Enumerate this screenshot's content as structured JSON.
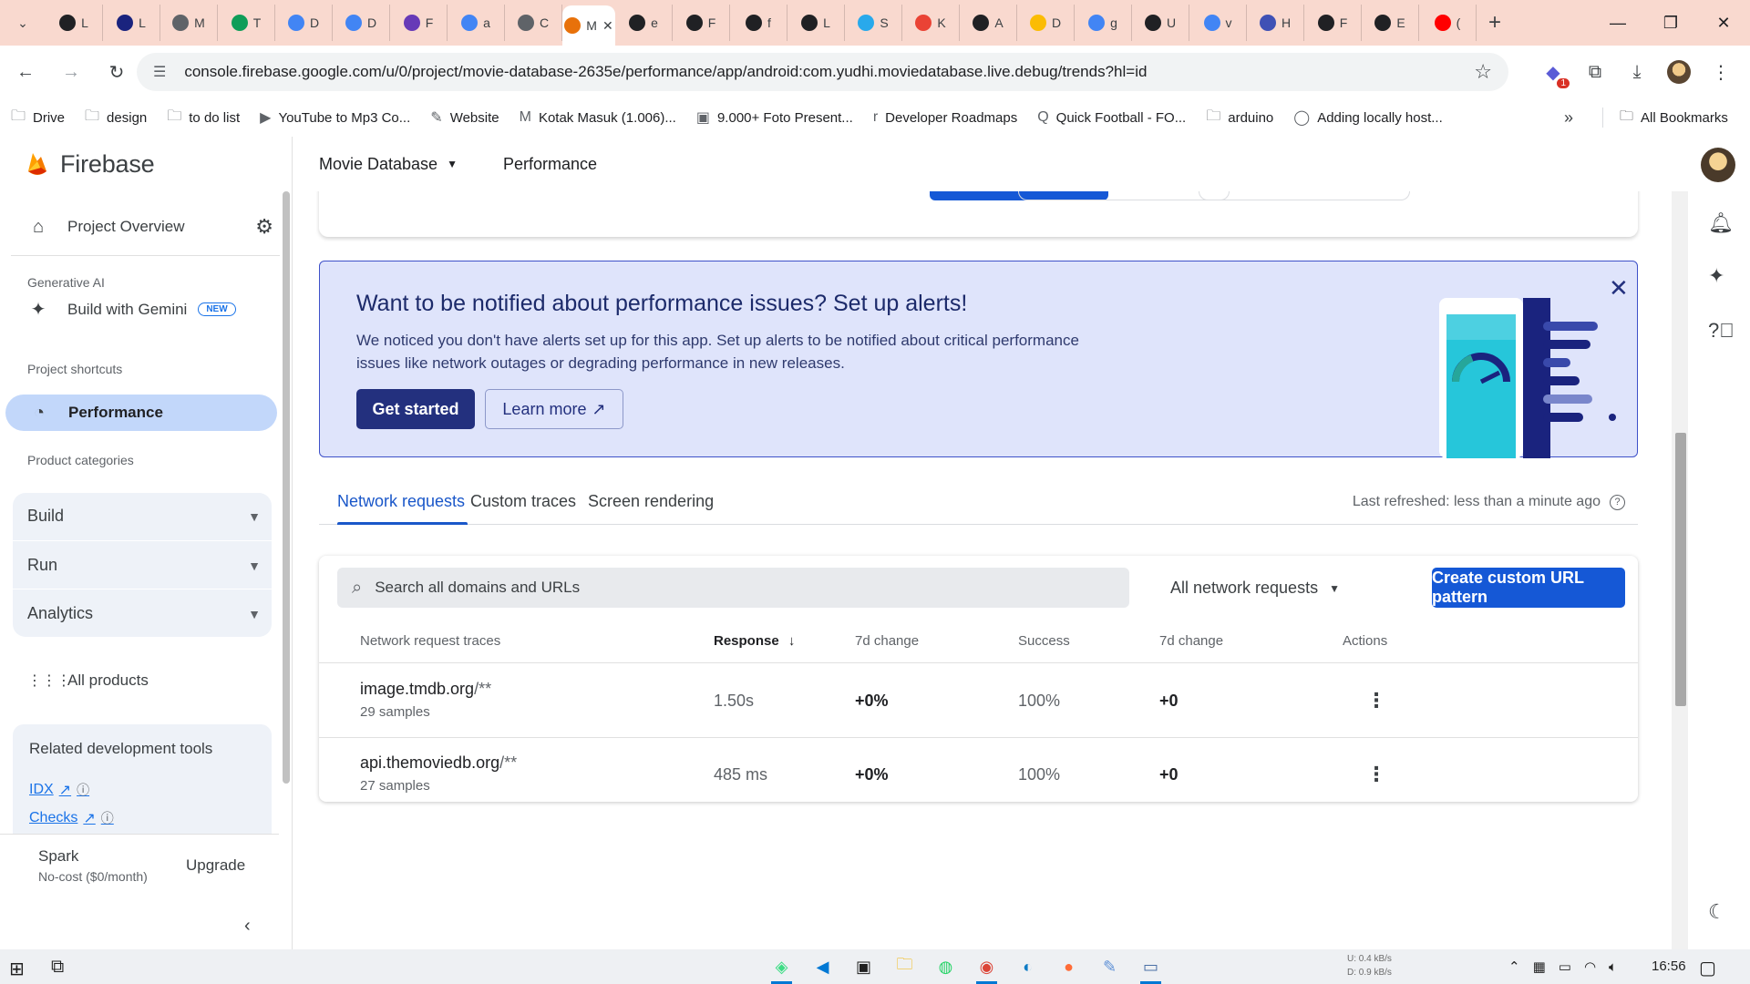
{
  "browser": {
    "tabs": [
      {
        "letter": "L",
        "color": "#202124"
      },
      {
        "letter": "L",
        "color": "#1a237e"
      },
      {
        "letter": "M",
        "color": "#5f6368"
      },
      {
        "letter": "T",
        "color": "#0f9d58"
      },
      {
        "letter": "D",
        "color": "#4285f4"
      },
      {
        "letter": "D",
        "color": "#4285f4"
      },
      {
        "letter": "F",
        "color": "#673ab7"
      },
      {
        "letter": "a",
        "color": "#4285f4"
      },
      {
        "letter": "C",
        "color": "#5f6368"
      },
      {
        "letter": "M",
        "color": "#e8710a",
        "active": true
      },
      {
        "letter": "e",
        "color": "#202124"
      },
      {
        "letter": "F",
        "color": "#202124"
      },
      {
        "letter": "f",
        "color": "#202124"
      },
      {
        "letter": "L",
        "color": "#202124"
      },
      {
        "letter": "S",
        "color": "#29a9eb"
      },
      {
        "letter": "K",
        "color": "#ea4335"
      },
      {
        "letter": "A",
        "color": "#202124"
      },
      {
        "letter": "D",
        "color": "#fbbc04"
      },
      {
        "letter": "g",
        "color": "#4285f4"
      },
      {
        "letter": "U",
        "color": "#202124"
      },
      {
        "letter": "v",
        "color": "#4285f4"
      },
      {
        "letter": "H",
        "color": "#3f51b5"
      },
      {
        "letter": "F",
        "color": "#202124"
      },
      {
        "letter": "E",
        "color": "#202124"
      },
      {
        "letter": "(",
        "color": "#ff0000"
      }
    ],
    "url": "console.firebase.google.com/u/0/project/movie-database-2635e/performance/app/android:com.yudhi.moviedatabase.live.debug/trends?hl=id",
    "ext_badge": "1",
    "bookmarks": [
      {
        "label": "Drive",
        "icon": "folder-icon"
      },
      {
        "label": "design",
        "icon": "folder-icon"
      },
      {
        "label": "to do list",
        "icon": "folder-icon"
      },
      {
        "label": "YouTube to Mp3 Co...",
        "icon": "download-icon"
      },
      {
        "label": "Website",
        "icon": "web-icon"
      },
      {
        "label": "Kotak Masuk (1.006)...",
        "icon": "gmail-icon"
      },
      {
        "label": "9.000+ Foto Present...",
        "icon": "photo-icon"
      },
      {
        "label": "Developer Roadmaps",
        "icon": "roadmap-icon"
      },
      {
        "label": "Quick Football - FO...",
        "icon": "search-icon"
      },
      {
        "label": "arduino",
        "icon": "folder-icon"
      },
      {
        "label": "Adding locally host...",
        "icon": "github-icon"
      }
    ],
    "all_bookmarks": "All Bookmarks"
  },
  "sidebar": {
    "brand": "Firebase",
    "project_overview": "Project Overview",
    "generative_ai_label": "Generative AI",
    "build_with_gemini": "Build with Gemini",
    "new_badge": "NEW",
    "shortcuts_label": "Project shortcuts",
    "performance": "Performance",
    "categories_label": "Product categories",
    "categories": [
      "Build",
      "Run",
      "Analytics"
    ],
    "all_products": "All products",
    "related_title": "Related development tools",
    "related_links": [
      "IDX",
      "Checks"
    ],
    "plan_name": "Spark",
    "plan_sub": "No-cost ($0/month)",
    "upgrade": "Upgrade"
  },
  "topbar": {
    "project": "Movie Database",
    "section": "Performance"
  },
  "alert": {
    "title": "Want to be notified about performance issues? Set up alerts!",
    "body": "We noticed you don't have alerts set up for this app. Set up alerts to be notified about critical performance issues like network outages or degrading performance in new releases.",
    "primary": "Get started",
    "secondary": "Learn more"
  },
  "tabs": {
    "items": [
      "Network requests",
      "Custom traces",
      "Screen rendering"
    ],
    "active": 0,
    "refreshed": "Last refreshed: less than a minute ago"
  },
  "table": {
    "search_placeholder": "Search all domains and URLs",
    "filter": "All network requests",
    "create_button": "Create custom URL pattern",
    "headers": {
      "trace": "Network request traces",
      "response": "Response",
      "change1": "7d change",
      "success": "Success",
      "change2": "7d change",
      "actions": "Actions"
    },
    "rows": [
      {
        "domain": "image.tmdb.org",
        "suffix": "/**",
        "samples": "29 samples",
        "response": "1.50s",
        "change1": "+0%",
        "success": "100%",
        "change2": "+0"
      },
      {
        "domain": "api.themoviedb.org",
        "suffix": "/**",
        "samples": "27 samples",
        "response": "485 ms",
        "change1": "+0%",
        "success": "100%",
        "change2": "+0"
      }
    ]
  },
  "taskbar": {
    "net_up": "U: 0.4 kB/s",
    "net_down": "D: 0.9 kB/s",
    "clock": "16:56"
  }
}
